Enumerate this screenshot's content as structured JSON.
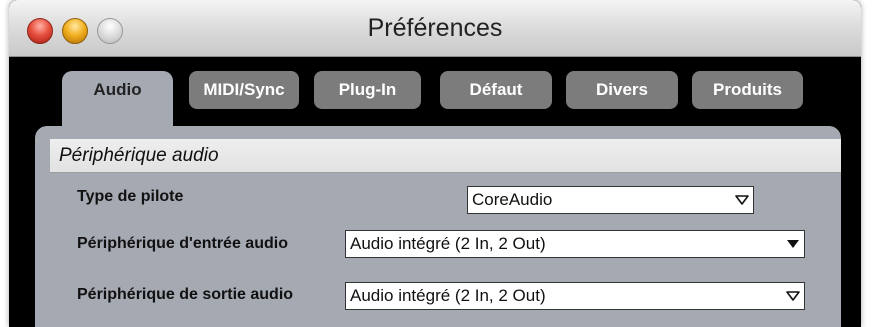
{
  "window": {
    "title": "Préférences"
  },
  "tabs": [
    {
      "label": "Audio",
      "active": true
    },
    {
      "label": "MIDI/Sync",
      "active": false
    },
    {
      "label": "Plug-In",
      "active": false
    },
    {
      "label": "Défaut",
      "active": false
    },
    {
      "label": "Divers",
      "active": false
    },
    {
      "label": "Produits",
      "active": false
    }
  ],
  "section": {
    "title": "Périphérique audio"
  },
  "fields": {
    "driver_type": {
      "label": "Type de pilote",
      "value": "CoreAudio"
    },
    "input_device": {
      "label": "Périphérique d'entrée audio",
      "value": "Audio intégré (2 In, 2 Out)"
    },
    "output_device": {
      "label": "Périphérique de sortie audio",
      "value": "Audio intégré (2 In, 2 Out)"
    }
  },
  "colors": {
    "window_background": "#000000",
    "panel_background": "#a4a9b2",
    "inactive_tab": "#7c7c7c",
    "close_button": "#e8513f",
    "minimize_button": "#f2b021"
  },
  "icons": {
    "dropdown_outline": "triangle-down-outline",
    "dropdown_filled": "triangle-down-filled"
  }
}
